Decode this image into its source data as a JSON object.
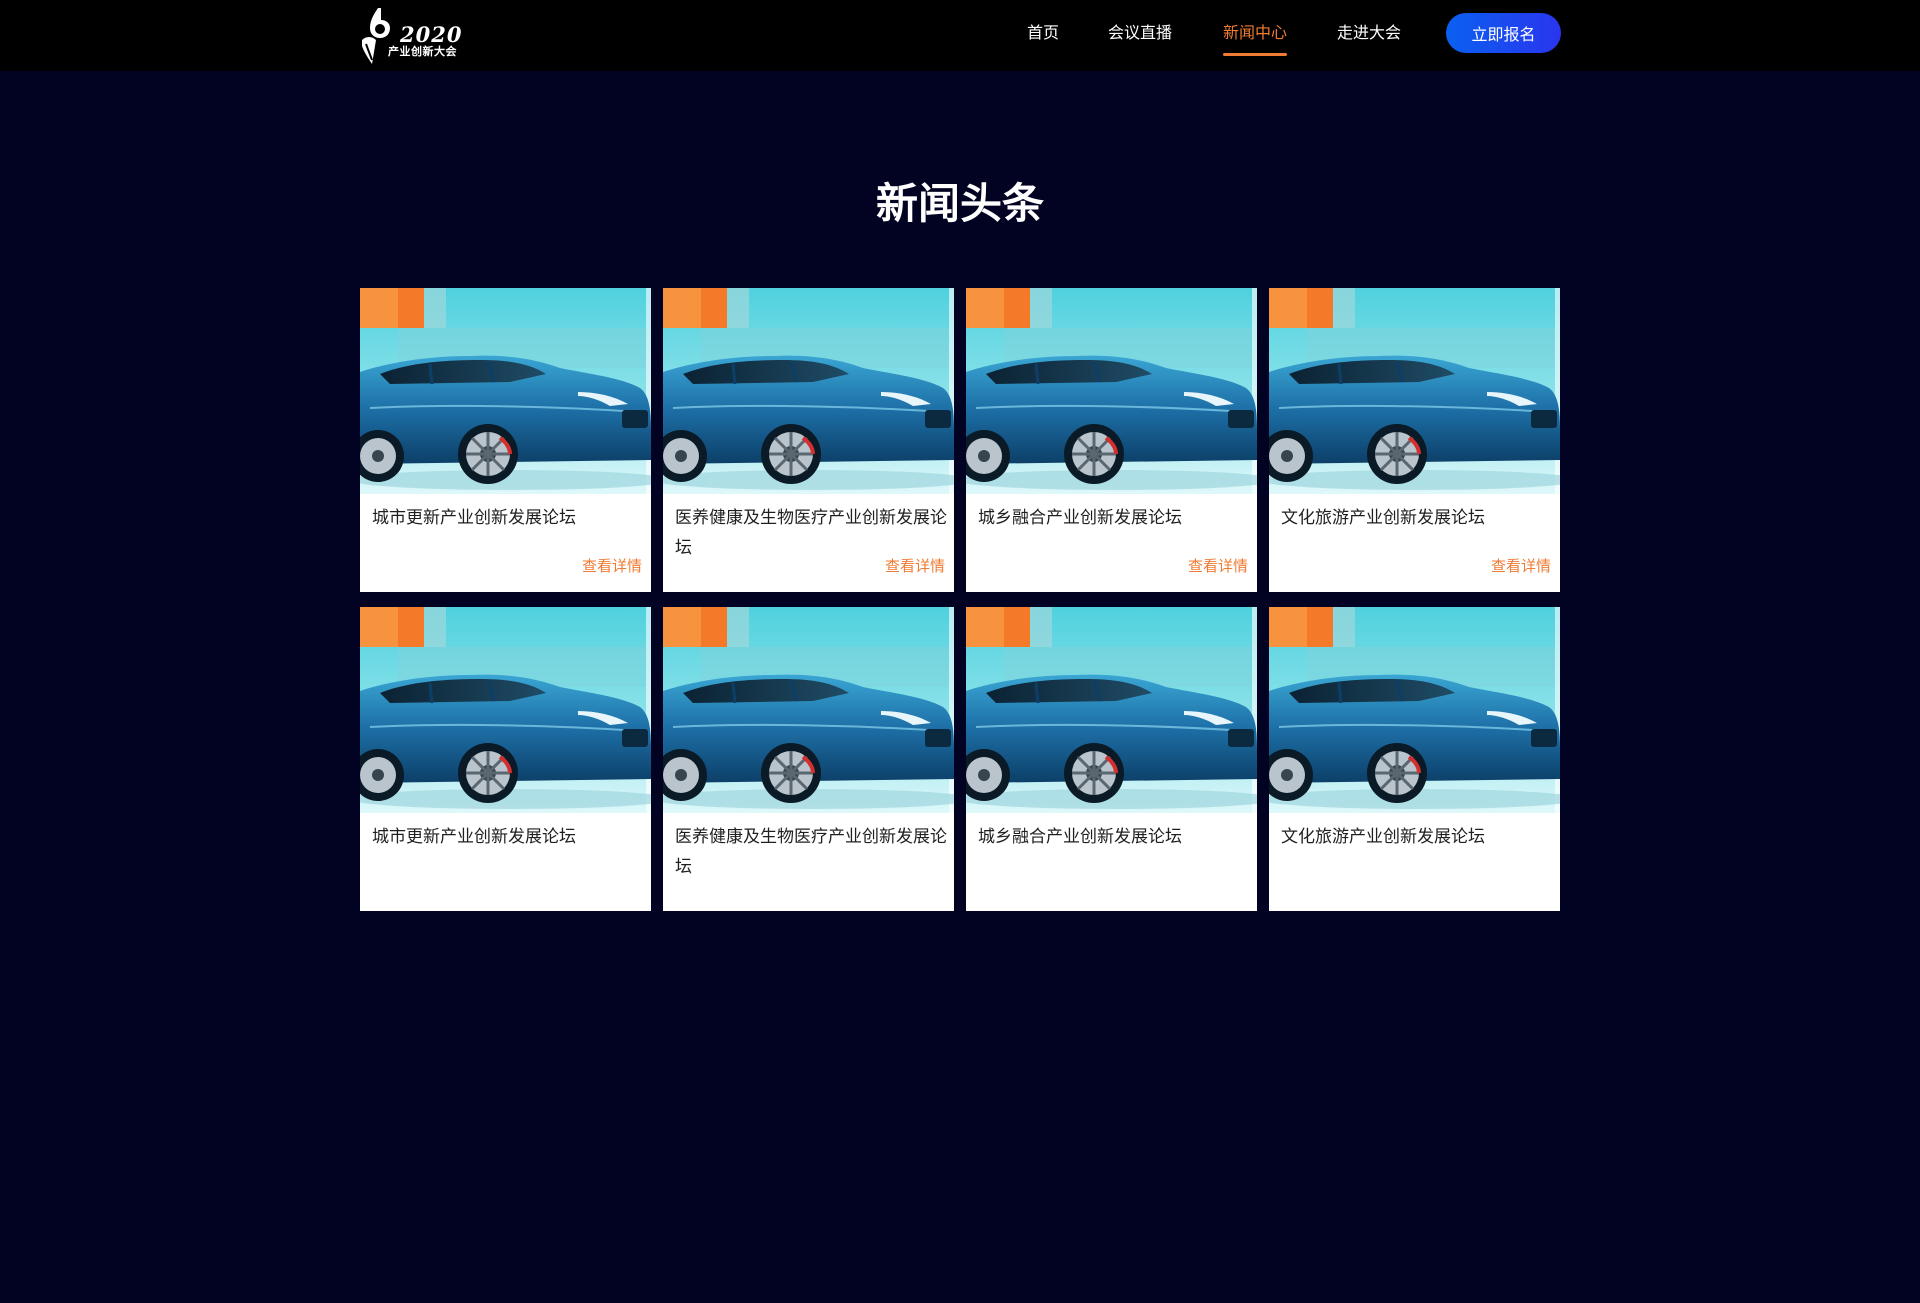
{
  "header": {
    "logo": {
      "year": "2020",
      "text": "产业创新大会"
    },
    "nav": [
      {
        "label": "首页",
        "active": false
      },
      {
        "label": "会议直播",
        "active": false
      },
      {
        "label": "新闻中心",
        "active": true
      },
      {
        "label": "走进大会",
        "active": false
      }
    ],
    "signup_label": "立即报名"
  },
  "main": {
    "title": "新闻头条",
    "cards": [
      {
        "title": "城市更新产业创新发展论坛",
        "more": "查看详情"
      },
      {
        "title": "医养健康及生物医疗产业创新发展论坛",
        "more": "查看详情"
      },
      {
        "title": "城乡融合产业创新发展论坛",
        "more": "查看详情"
      },
      {
        "title": "文化旅游产业创新发展论坛",
        "more": "查看详情"
      },
      {
        "title": "城市更新产业创新发展论坛",
        "more": ""
      },
      {
        "title": "医养健康及生物医疗产业创新发展论坛",
        "more": ""
      },
      {
        "title": "城乡融合产业创新发展论坛",
        "more": ""
      },
      {
        "title": "文化旅游产业创新发展论坛",
        "more": ""
      }
    ]
  },
  "colors": {
    "page_background": "#020222",
    "header_background": "#000000",
    "accent": "#f07b33",
    "button_gradient_start": "#0a60f0",
    "button_gradient_end": "#2a35ee"
  }
}
